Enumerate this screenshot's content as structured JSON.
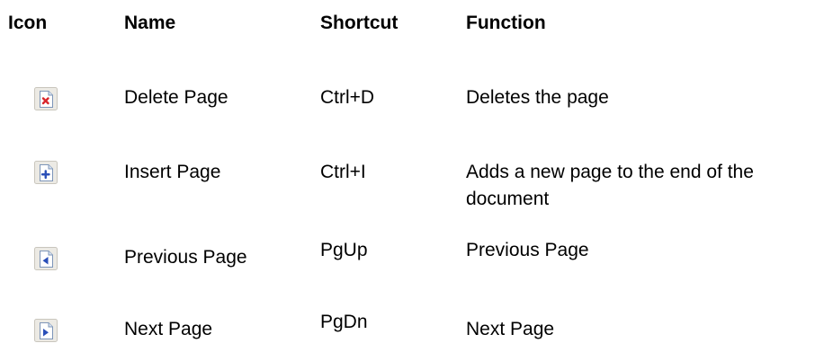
{
  "headers": {
    "icon": "Icon",
    "name": "Name",
    "shortcut": "Shortcut",
    "function": "Function"
  },
  "rows": [
    {
      "icon": "delete-page-icon",
      "name": "Delete Page",
      "shortcut": "Ctrl+D",
      "function": "Deletes the page"
    },
    {
      "icon": "insert-page-icon",
      "name": "Insert Page",
      "shortcut": "Ctrl+I",
      "function": "Adds a new page to the end of the document"
    },
    {
      "icon": "previous-page-icon",
      "name": "Previous Page",
      "shortcut": "PgUp",
      "function": "Previous Page"
    },
    {
      "icon": "next-page-icon",
      "name": "Next Page",
      "shortcut": "PgDn",
      "function": "Next Page"
    }
  ],
  "colors": {
    "delete_mark": "#d8262c",
    "action_mark": "#2a4fb8",
    "page_fold": "#7a9fc8"
  }
}
